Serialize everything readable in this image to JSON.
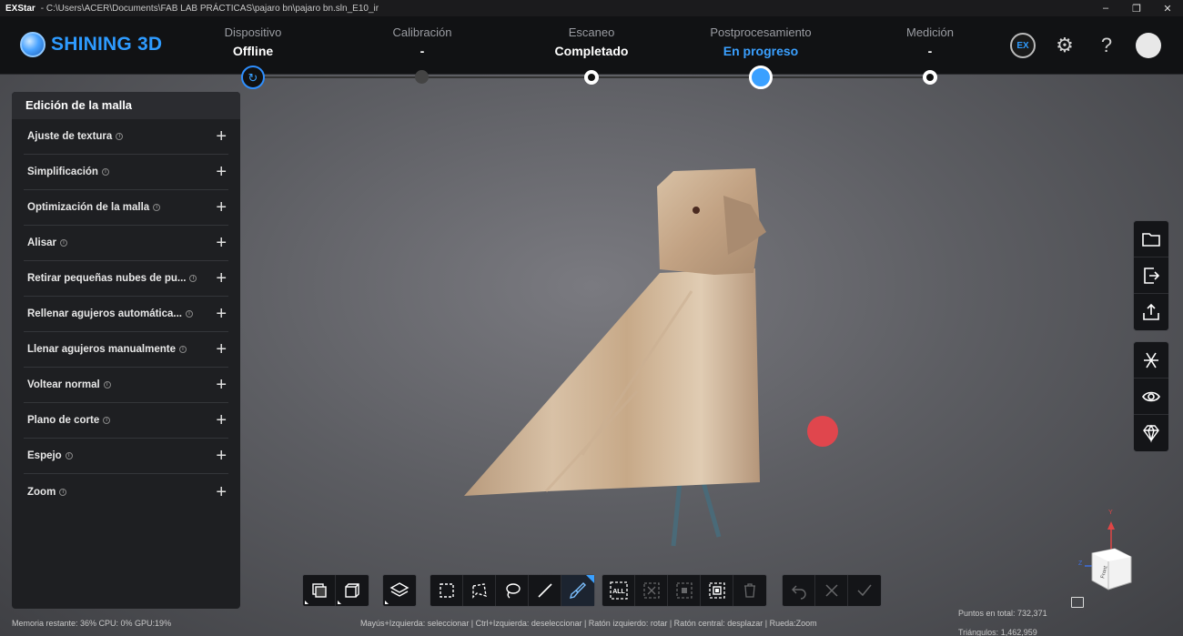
{
  "titlebar": {
    "app": "EXStar",
    "path": "-  C:\\Users\\ACER\\Documents\\FAB LAB PRÁCTICAS\\pajaro bn\\pajaro bn.sln_E10_ir"
  },
  "header": {
    "brand": "SHINING 3D",
    "steps": [
      {
        "label": "Dispositivo",
        "status": "Offline"
      },
      {
        "label": "Calibración",
        "status": "-"
      },
      {
        "label": "Escaneo",
        "status": "Completado"
      },
      {
        "label": "Postprocesamiento",
        "status": "En progreso"
      },
      {
        "label": "Medición",
        "status": "-"
      }
    ],
    "ex_badge": "EX"
  },
  "panel": {
    "title": "Edición de la malla",
    "items": [
      "Ajuste de textura",
      "Simplificación",
      "Optimización de la malla",
      "Alisar",
      "Retirar pequeñas nubes de pu...",
      "Rellenar agujeros automática...",
      "Llenar agujeros manualmente",
      "Voltear normal",
      "Plano de corte",
      "Espejo",
      "Zoom"
    ]
  },
  "toolbar": {
    "all_label": "ALL"
  },
  "axis": {
    "y_label": "Y",
    "z_label": "Z",
    "cube_face": "Front"
  },
  "status": {
    "left": "Memoria restante: 36% CPU: 0% GPU:19%",
    "hint": "Mayús+Izquierda: seleccionar | Ctrl+Izquierda: deseleccionar | Ratón izquierdo: rotar | Ratón central: desplazar | Rueda:Zoom",
    "points": "Puntos en total: 732,371",
    "triangles": "Triángulos: 1,462,959"
  },
  "colors": {
    "accent": "#3aa0ff",
    "marker": "#e0464d"
  }
}
